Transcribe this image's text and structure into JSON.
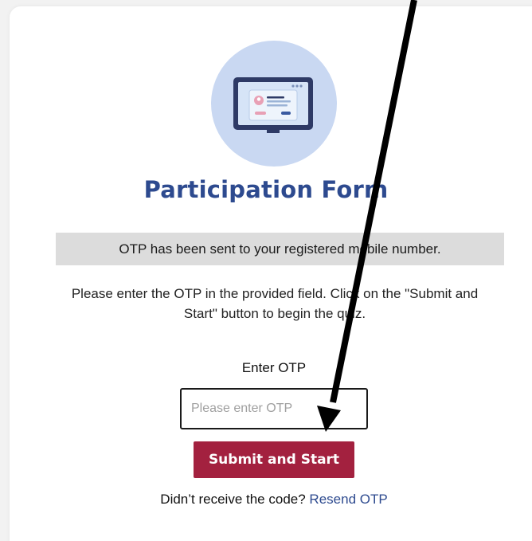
{
  "form": {
    "title": "Participation Form",
    "notice": "OTP has been sent to your registered mobile number.",
    "instructions": "Please enter the OTP in the provided field. Click on the \"Submit and Start\" button to begin the quiz.",
    "otp_label": "Enter OTP",
    "otp_placeholder": "Please enter OTP",
    "otp_value": "",
    "submit_label": "Submit and Start",
    "resend_prompt": "Didn’t receive the code?",
    "resend_link": "Resend OTP"
  },
  "colors": {
    "title": "#2d4a8f",
    "submit_button": "#a3213f",
    "notice_bg": "#dcdcdc",
    "hero_circle": "#c9d8f2",
    "link": "#2d4a8f"
  },
  "icons": {
    "hero": "form-monitor-icon",
    "annotation": "annotation-arrow"
  }
}
